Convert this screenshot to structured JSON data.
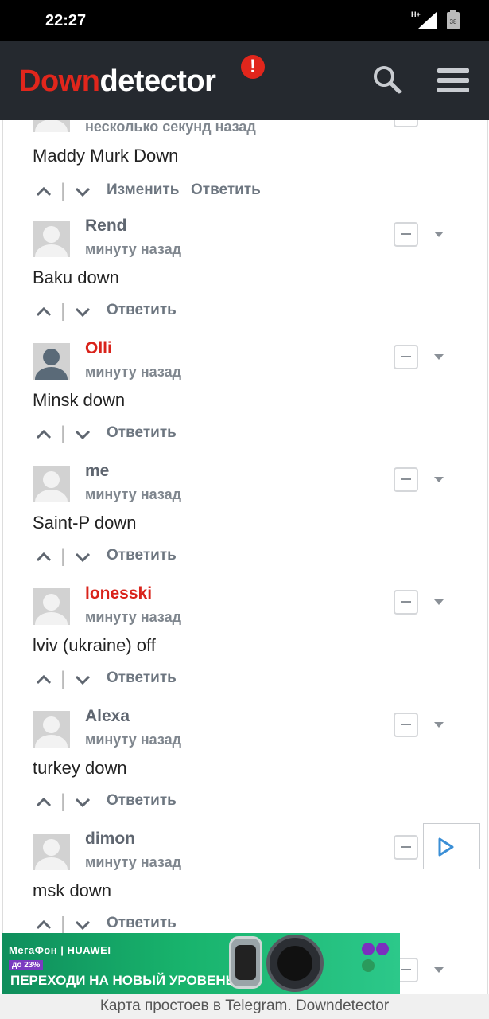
{
  "status_bar": {
    "time": "22:27",
    "network": "H+",
    "battery": "38"
  },
  "header": {
    "logo_part1": "Down",
    "logo_part2": "detector",
    "logo_badge": "!"
  },
  "comments": [
    {
      "author": "",
      "time": "несколько секунд назад",
      "text": "Maddy Murk Down",
      "actions": [
        "Изменить",
        "Ответить"
      ]
    },
    {
      "author": "Rend",
      "time": "минуту назад",
      "text": "Baku down",
      "actions": [
        "Ответить"
      ]
    },
    {
      "author": "Olli",
      "time": "минуту назад",
      "text": "Minsk down",
      "actions": [
        "Ответить"
      ]
    },
    {
      "author": "me",
      "time": "минуту назад",
      "text": "Saint-P down",
      "actions": [
        "Ответить"
      ]
    },
    {
      "author": "lonesski",
      "time": "минуту назад",
      "text": "lviv (ukraine) off",
      "actions": [
        "Ответить"
      ]
    },
    {
      "author": "Alexa",
      "time": "минуту назад",
      "text": "turkey down",
      "actions": [
        "Ответить"
      ]
    },
    {
      "author": "dimon",
      "time": "минуту назад",
      "text": "msk down",
      "actions": [
        "Ответить"
      ]
    }
  ],
  "ad": {
    "brand": "МегаФон | HUAWEI",
    "promo": "до 23%",
    "headline": "ПЕРЕХОДИ НА НОВЫЙ УРОВЕНЬ"
  },
  "footer": {
    "text": "Карта простоев в Telegram. Downdetector"
  },
  "colors": {
    "brand_red": "#e1261c",
    "header_bg": "#25292f",
    "moderator_red": "#d9231b",
    "muted_text": "#7f868e"
  }
}
